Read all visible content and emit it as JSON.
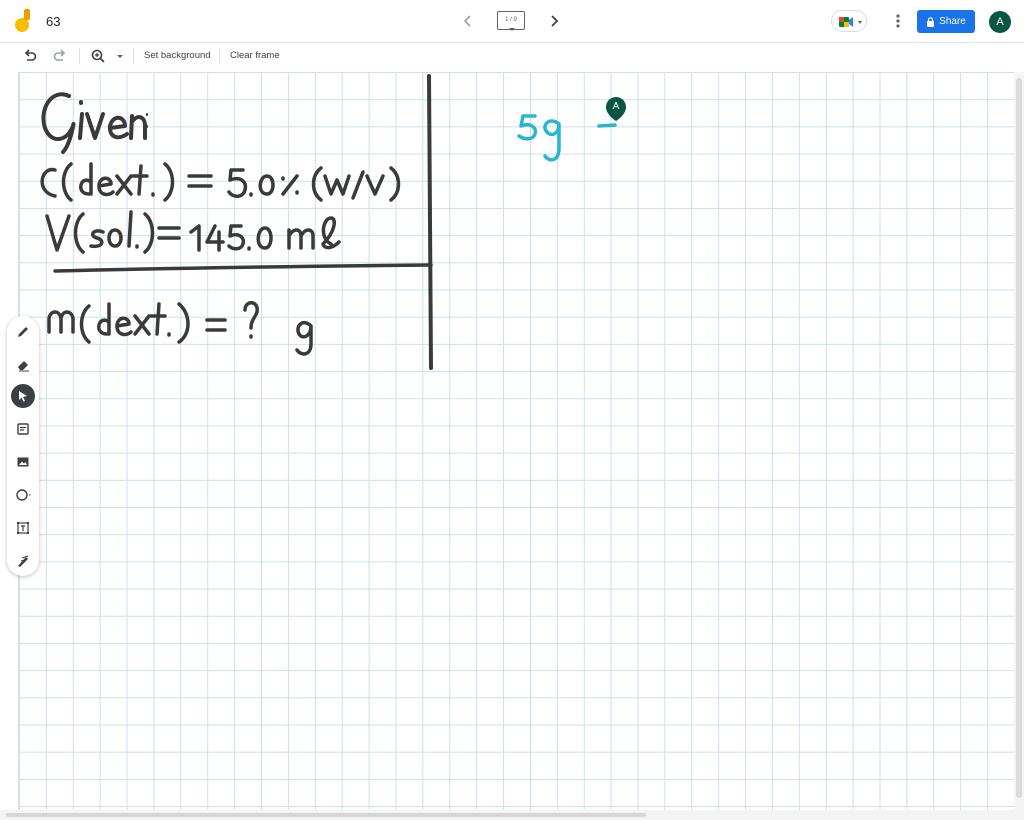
{
  "header": {
    "doc_title": "63",
    "frame_indicator": "1 / 9",
    "share_label": "Share",
    "avatar_initial": "A"
  },
  "toolbar": {
    "set_background_label": "Set background",
    "clear_frame_label": "Clear frame"
  },
  "board": {
    "cursor_label": "A"
  },
  "icons": {
    "undo": "undo-icon",
    "redo": "redo-icon",
    "zoom": "zoom-icon",
    "pen": "pen-icon",
    "eraser": "eraser-icon",
    "select": "select-icon",
    "sticky_note": "sticky-note-icon",
    "image": "image-icon",
    "shape": "circle-icon",
    "text_box": "text-box-icon",
    "laser": "laser-icon"
  },
  "colors": {
    "share_button": "#1a73e8",
    "avatar": "#0b5545",
    "grid": "#cbe0ea",
    "ink_black": "#3a3a3a",
    "ink_cyan": "#27b7cf"
  }
}
